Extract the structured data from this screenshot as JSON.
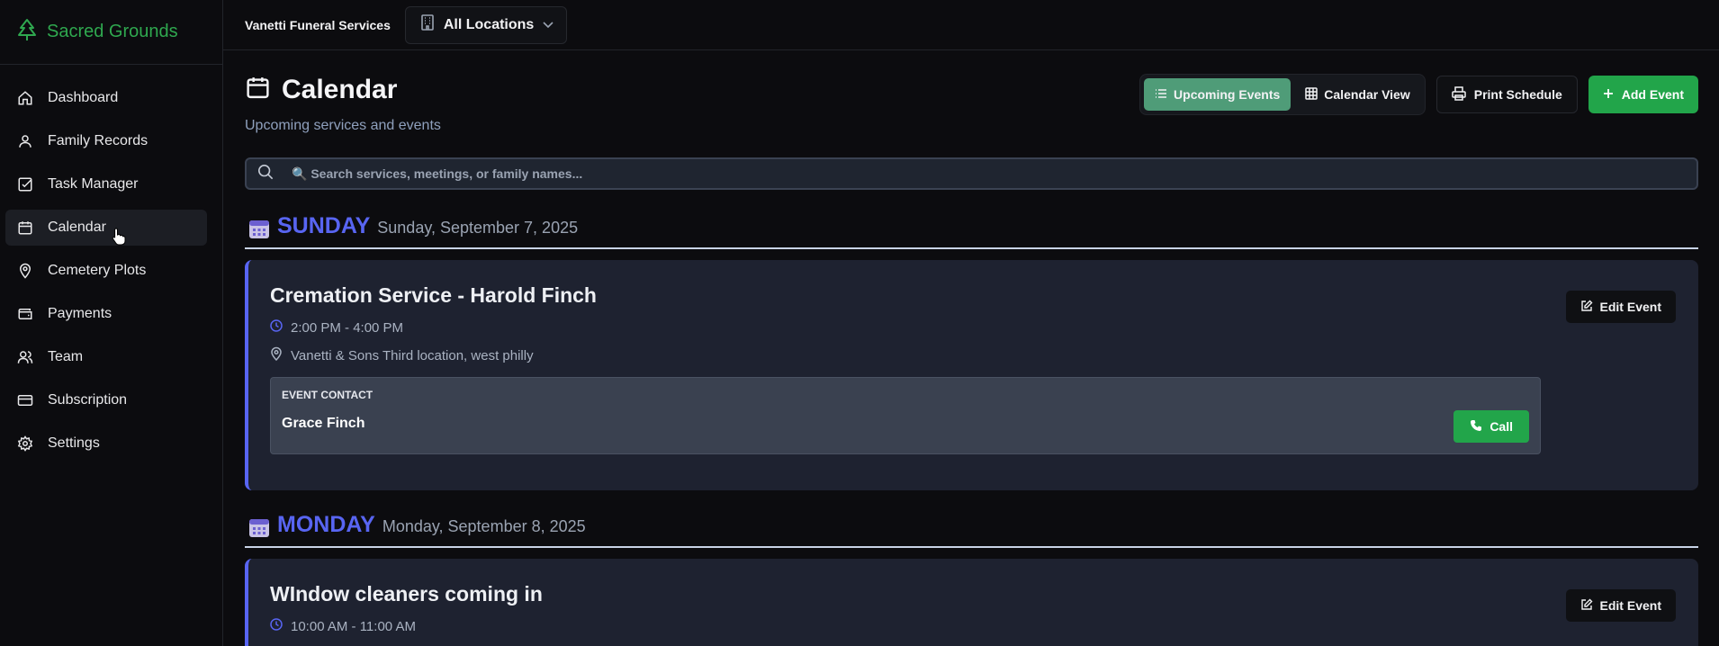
{
  "brand": {
    "name": "Sacred Grounds",
    "icon": "tree-icon",
    "color": "#2fa84f"
  },
  "sidebar": {
    "items": [
      {
        "label": "Dashboard",
        "icon": "home-icon",
        "active": false
      },
      {
        "label": "Family Records",
        "icon": "user-icon",
        "active": false
      },
      {
        "label": "Task Manager",
        "icon": "checkbox-icon",
        "active": false
      },
      {
        "label": "Calendar",
        "icon": "calendar-icon",
        "active": true
      },
      {
        "label": "Cemetery Plots",
        "icon": "map-pin-icon",
        "active": false
      },
      {
        "label": "Payments",
        "icon": "wallet-icon",
        "active": false
      },
      {
        "label": "Team",
        "icon": "users-icon",
        "active": false
      },
      {
        "label": "Subscription",
        "icon": "credit-card-icon",
        "active": false
      },
      {
        "label": "Settings",
        "icon": "gear-icon",
        "active": false
      }
    ]
  },
  "topbar": {
    "org_name": "Vanetti Funeral Services",
    "location_select": "All Locations"
  },
  "page": {
    "title": "Calendar",
    "subtitle": "Upcoming services and events"
  },
  "toolbar": {
    "upcoming_label": "Upcoming Events",
    "calendar_view_label": "Calendar View",
    "active_view": "Upcoming Events",
    "print_label": "Print Schedule",
    "add_label": "Add Event"
  },
  "search": {
    "placeholder": "🔍 Search services, meetings, or family names..."
  },
  "days": [
    {
      "day_name": "SUNDAY",
      "date": "Sunday, September 7, 2025",
      "events": [
        {
          "title": "Cremation Service - Harold Finch",
          "time": "2:00 PM - 4:00 PM",
          "location": "Vanetti & Sons Third location, west philly",
          "edit_label": "Edit Event",
          "contact_label": "EVENT CONTACT",
          "contact_name": "Grace Finch",
          "call_label": "Call"
        }
      ]
    },
    {
      "day_name": "MONDAY",
      "date": "Monday, September 8, 2025",
      "events": [
        {
          "title": "WIndow cleaners coming in",
          "time": "10:00 AM - 11:00 AM",
          "edit_label": "Edit Event"
        }
      ]
    }
  ],
  "colors": {
    "accent_blue": "#5865f2",
    "green": "#22a54a",
    "active_toggle": "#4f9c78"
  }
}
